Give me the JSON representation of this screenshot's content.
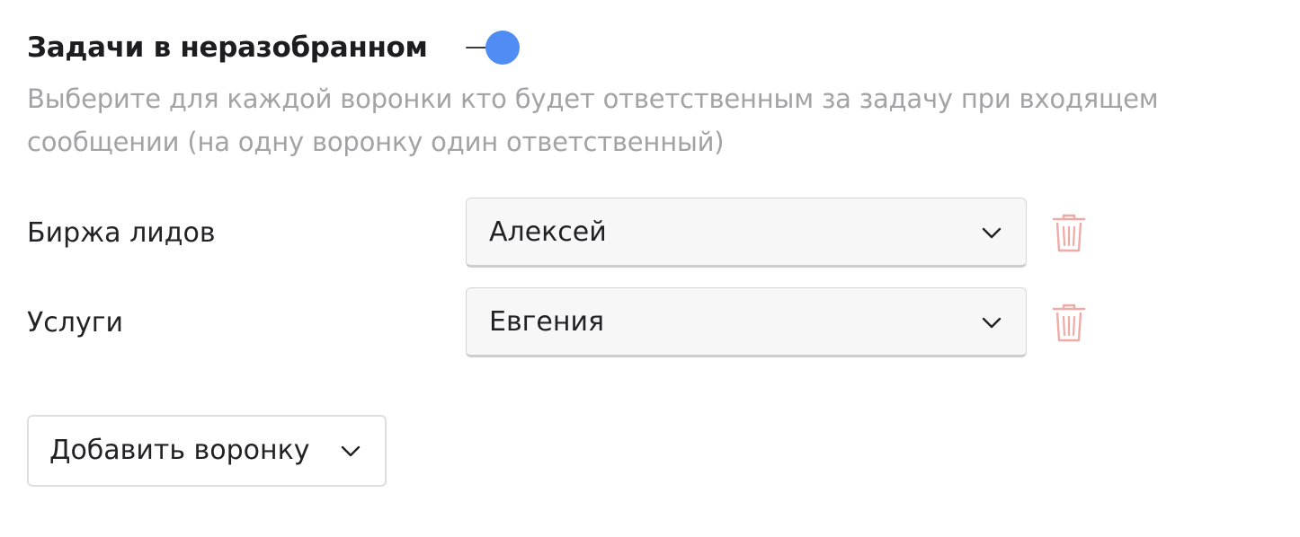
{
  "section": {
    "title": "Задачи в неразобранном",
    "toggle_on": true,
    "description": "Выберите для каждой воронки кто будет ответственным за задачу при входящем сообщении (на одну воронку один ответственный)"
  },
  "pipelines": [
    {
      "label": "Биржа лидов",
      "responsible": "Алексей",
      "chevron_icon": "chevron-down-icon",
      "delete_icon": "trash-icon"
    },
    {
      "label": "Услуги",
      "responsible": "Евгения",
      "chevron_icon": "chevron-down-icon",
      "delete_icon": "trash-icon"
    }
  ],
  "add_pipeline": {
    "label": "Добавить воронку",
    "icon": "chevron-down-icon"
  },
  "colors": {
    "toggle_accent": "#4f8df5",
    "delete_icon": "#f0aaa6",
    "description_text": "#a3a3a6",
    "select_background": "#f7f7f8"
  }
}
